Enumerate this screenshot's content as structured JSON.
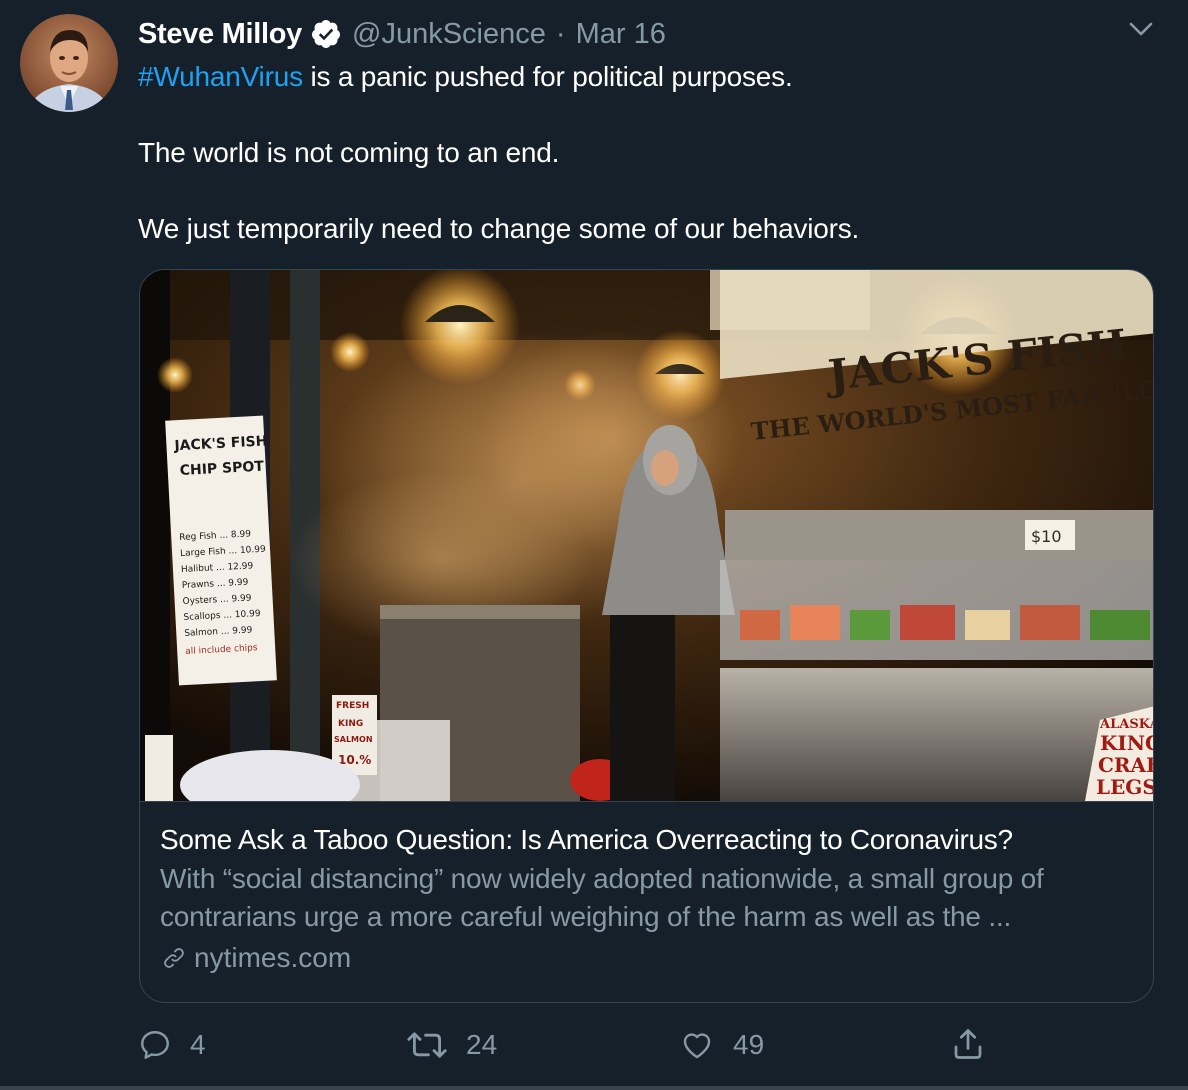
{
  "author": {
    "name": "Steve Milloy",
    "handle": "@JunkScience",
    "separator": "·",
    "date": "Mar 16",
    "verified": true,
    "avatar_icon": "avatar-portrait-icon"
  },
  "tweet": {
    "hashtag": "#WuhanVirus",
    "line1_rest": " is a panic pushed for political purposes.",
    "line2": "The world is not coming to an end.",
    "line3": "We just temporarily need to change some of our behaviors."
  },
  "card": {
    "image": {
      "signs": {
        "jacks_left": "JACK'S FISH",
        "chip_spot": "CHIP SPOT",
        "wall_name": "JACK'S FISH",
        "wall_tagline": "THE WORLD'S MOST FABULOUS",
        "price_tag": "$10",
        "crab1": "ALASKA",
        "crab2": "KING",
        "crab3": "CRAB",
        "crab4": "LEGS",
        "salmon1": "FRESH",
        "salmon2": "KING",
        "salmon3": "SALMON",
        "salmon4": "10.%"
      },
      "menu": [
        "Reg Fish ... 8.99",
        "Large Fish ... 10.99",
        "Halibut ... 12.99",
        "Prawns ... 9.99",
        "Oysters ... 9.99",
        "Scallops ... 10.99",
        "Salmon ... 9.99",
        "all include chips"
      ]
    },
    "title": "Some Ask a Taboo Question: Is America Overreacting to Coronavirus?",
    "description": "With “social distancing” now widely adopted nationwide, a small group of contrarians urge a more careful weighing of the harm as well as the ...",
    "domain": "nytimes.com"
  },
  "actions": {
    "replies": "4",
    "retweets": "24",
    "likes": "49"
  },
  "colors": {
    "background": "#15202b",
    "link": "#1da1f2",
    "muted": "#8899a6",
    "border": "#38444d"
  }
}
